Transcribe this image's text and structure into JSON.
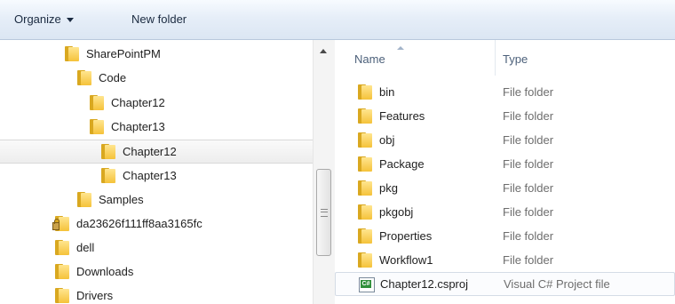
{
  "toolbar": {
    "organize_label": "Organize",
    "new_folder_label": "New folder"
  },
  "tree": {
    "items": [
      {
        "label": "SharePointPM",
        "icon": "folder-icon",
        "indent": 0
      },
      {
        "label": "Code",
        "icon": "folder-icon",
        "indent": 1
      },
      {
        "label": "Chapter12",
        "icon": "folder-icon",
        "indent": 2
      },
      {
        "label": "Chapter13",
        "icon": "folder-icon",
        "indent": 2
      },
      {
        "label": "Chapter12",
        "icon": "folder-icon",
        "indent": 3,
        "selected": true
      },
      {
        "label": "Chapter13",
        "icon": "folder-icon",
        "indent": 3
      },
      {
        "label": "Samples",
        "icon": "folder-icon",
        "indent": 1
      },
      {
        "label": "da23626f111ff8aa3165fc",
        "icon": "locked-folder-icon",
        "indent": -1
      },
      {
        "label": "dell",
        "icon": "folder-icon",
        "indent": -1
      },
      {
        "label": "Downloads",
        "icon": "folder-icon",
        "indent": -1
      },
      {
        "label": "Drivers",
        "icon": "folder-icon",
        "indent": -1
      }
    ]
  },
  "list": {
    "columns": {
      "name": "Name",
      "type": "Type"
    },
    "files": [
      {
        "name": "bin",
        "type": "File folder",
        "icon": "folder-icon"
      },
      {
        "name": "Features",
        "type": "File folder",
        "icon": "folder-icon"
      },
      {
        "name": "obj",
        "type": "File folder",
        "icon": "folder-icon"
      },
      {
        "name": "Package",
        "type": "File folder",
        "icon": "folder-icon"
      },
      {
        "name": "pkg",
        "type": "File folder",
        "icon": "folder-icon"
      },
      {
        "name": "pkgobj",
        "type": "File folder",
        "icon": "folder-icon"
      },
      {
        "name": "Properties",
        "type": "File folder",
        "icon": "folder-icon"
      },
      {
        "name": "Workflow1",
        "type": "File folder",
        "icon": "folder-icon"
      },
      {
        "name": "Chapter12.csproj",
        "type": "Visual C# Project file",
        "icon": "csharp-project-icon",
        "hovered": true
      }
    ]
  },
  "colors": {
    "toolbar_bg": "#dbe6f3",
    "folder_yellow": "#f5c23a",
    "header_text": "#4c607a",
    "type_text": "#6d6d6d"
  }
}
